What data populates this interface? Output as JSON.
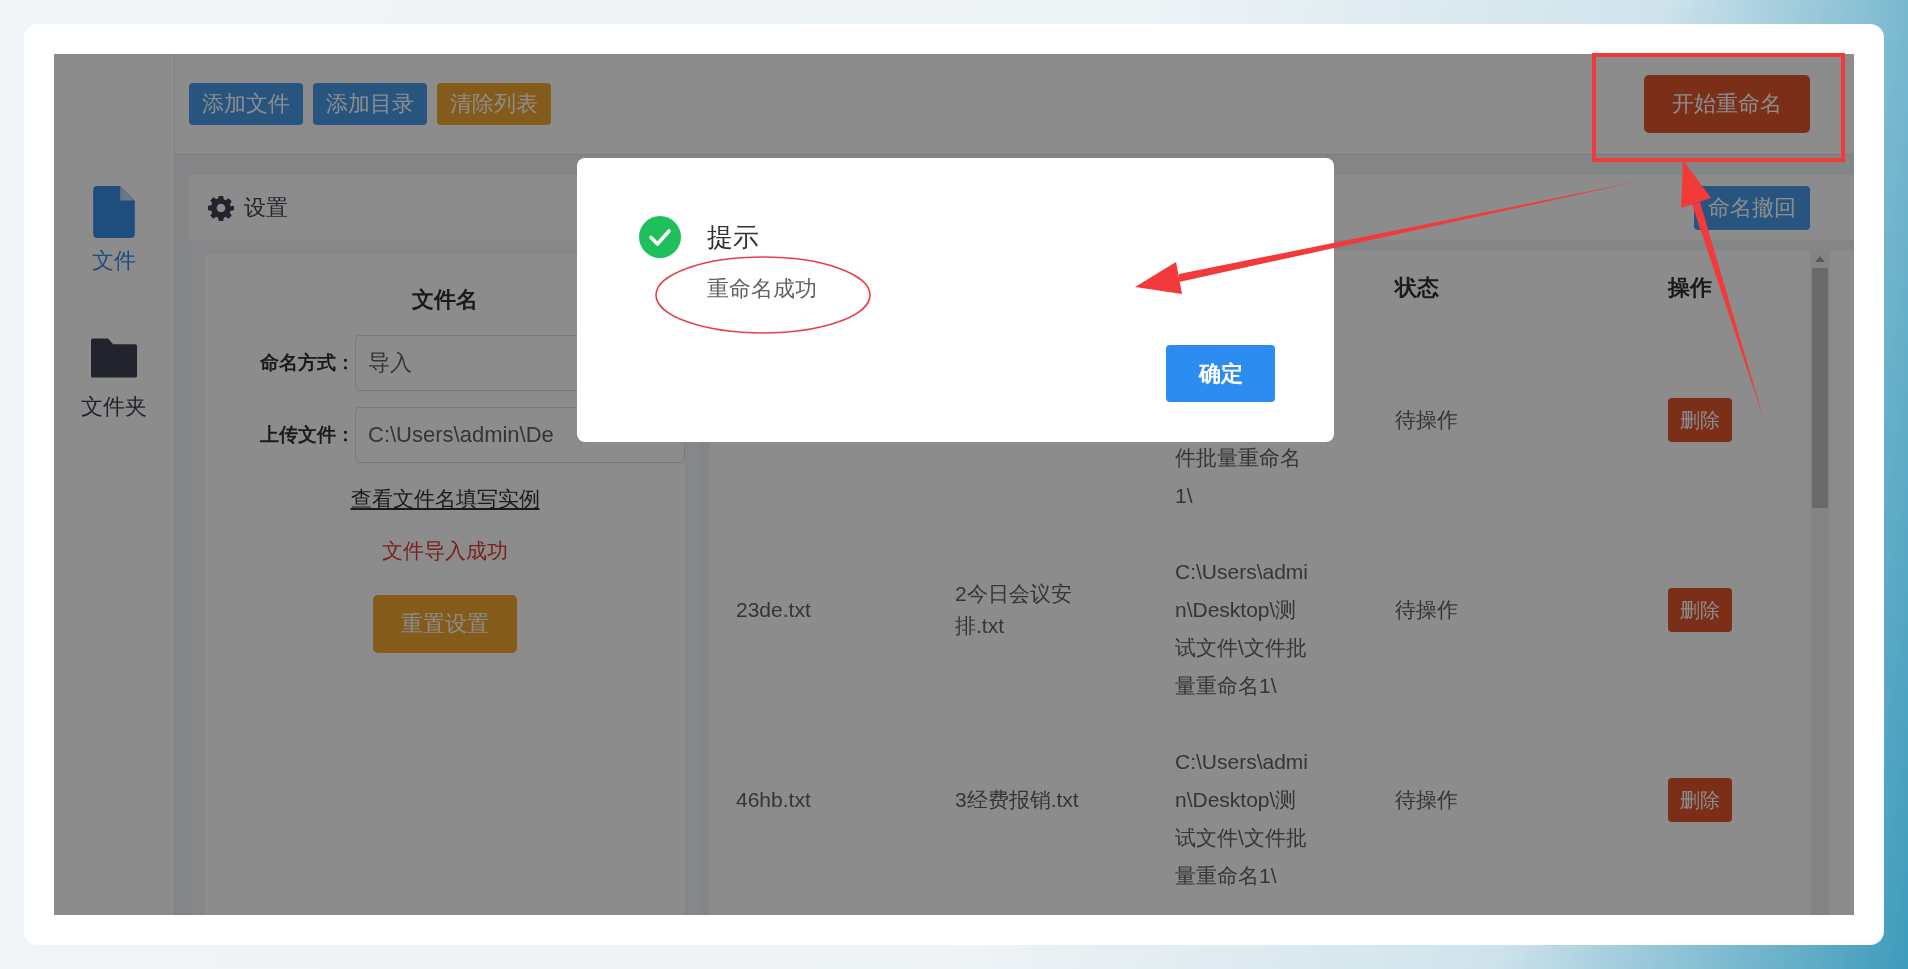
{
  "sidebar": {
    "items": [
      {
        "label": "文件",
        "kind": "file",
        "selected": true
      },
      {
        "label": "文件夹",
        "kind": "folder",
        "selected": false
      }
    ]
  },
  "toolbar": {
    "buttons": [
      {
        "label": "添加文件",
        "kind": "primary"
      },
      {
        "label": "添加目录",
        "kind": "primary"
      },
      {
        "label": "清除列表",
        "kind": "warning"
      }
    ],
    "start_button": "开始重命名"
  },
  "settings": {
    "title": "设置",
    "section_title": "文件名",
    "fields": [
      {
        "label": "命名方式：",
        "value": "导入"
      },
      {
        "label": "上传文件：",
        "value": "C:\\Users\\admin\\De"
      }
    ],
    "example_link": "查看文件名填写实例",
    "status_message": "文件导入成功",
    "reset_button": "重置设置"
  },
  "table": {
    "undo_button": "命名撤回",
    "columns": [
      {
        "kind": "status",
        "label": "状态"
      },
      {
        "kind": "action",
        "label": "操作"
      }
    ],
    "rows": [
      {
        "column_3": "件批量重命名1\\",
        "status": "待操作",
        "action": "删除"
      },
      {
        "column_1": "23de.txt",
        "column_2": "2今日会议安排.txt",
        "column_3": "C:\\Users\\admin\\Desktop\\测试文件\\文件批量重命名1\\",
        "status": "待操作",
        "action": "删除"
      },
      {
        "column_1": "46hb.txt",
        "column_2": "3经费报销.txt",
        "column_3": "C:\\Users\\admin\\Desktop\\测试文件\\文件批量重命名1\\",
        "status": "待操作",
        "action": "删除"
      }
    ]
  },
  "dialog": {
    "kind": "success",
    "title": "提示",
    "message": "重命名成功",
    "confirm_button": "确定"
  }
}
